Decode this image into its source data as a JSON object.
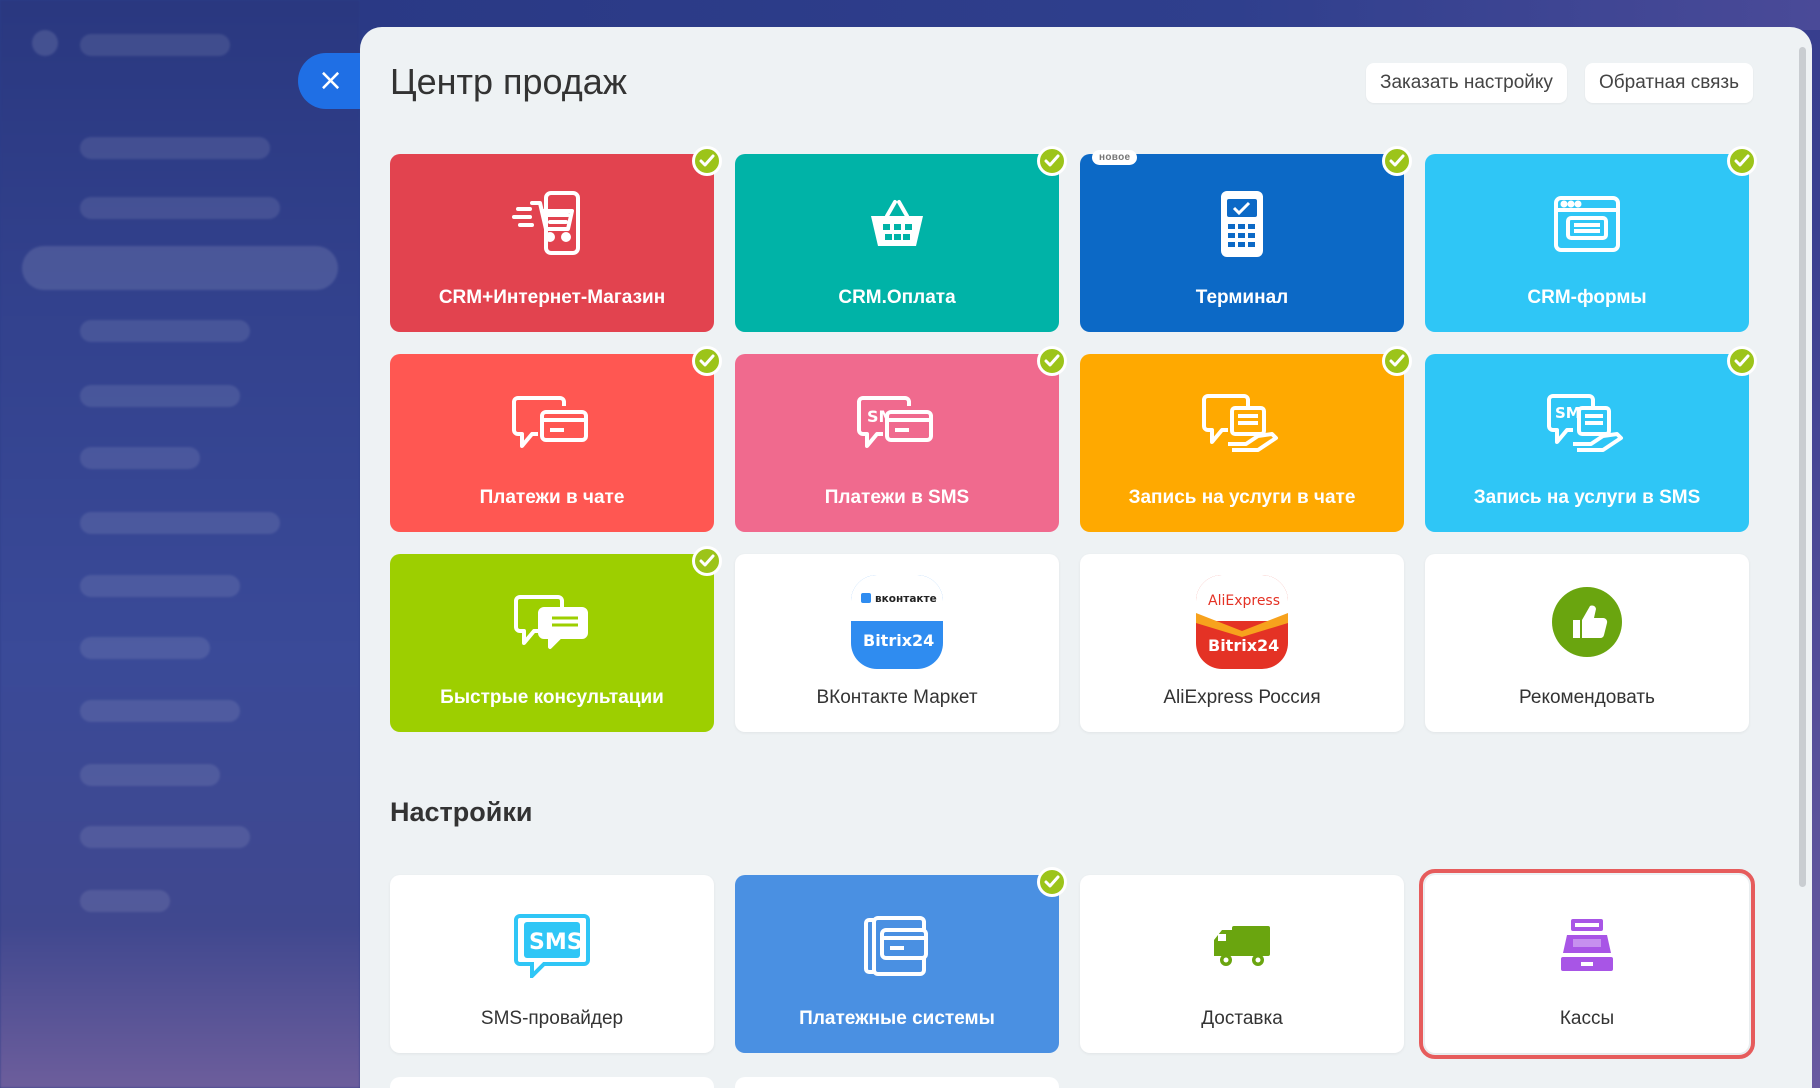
{
  "header": {
    "title": "Центр продаж",
    "order_setup_label": "Заказать настройку",
    "feedback_label": "Обратная связь",
    "close_label": "×"
  },
  "settings_title": "Настройки",
  "new_badge": "новое",
  "tiles": [
    {
      "label": "CRM+Интернет-Магазин",
      "color": "#e2434f",
      "icon": "shopping-cart-phone-icon",
      "checked": true
    },
    {
      "label": "CRM.Оплата",
      "color": "#00b3a7",
      "icon": "basket-icon",
      "checked": true
    },
    {
      "label": "Терминал",
      "color": "#0c69c6",
      "icon": "payment-terminal-icon",
      "checked": true
    },
    {
      "label": "CRM-формы",
      "color": "#2fc6f6",
      "icon": "web-form-icon",
      "checked": true
    },
    {
      "label": "Платежи в чате",
      "color": "#ff5752",
      "icon": "chat-card-icon",
      "checked": true
    },
    {
      "label": "Платежи в SMS",
      "color": "#f06a8e",
      "icon": "sms-card-icon",
      "checked": true
    },
    {
      "label": "Запись на услуги в чате",
      "color": "#ffa900",
      "icon": "chat-booking-icon",
      "checked": true
    },
    {
      "label": "Запись на услуги в SMS",
      "color": "#2fc6f6",
      "icon": "sms-booking-icon",
      "checked": true
    },
    {
      "label": "Быстрые консультации",
      "color": "#9dcf00",
      "icon": "chat-bubbles-icon",
      "checked": true
    },
    {
      "label": "ВКонтакте Маркет",
      "color": "#ffffff",
      "icon": "vk-bitrix24-logo",
      "checked": false
    },
    {
      "label": "AliExpress Россия",
      "color": "#ffffff",
      "icon": "aliexpress-bitrix24-logo",
      "checked": false
    },
    {
      "label": "Рекомендовать",
      "color": "#ffffff",
      "icon": "thumbs-up-icon",
      "checked": false
    }
  ],
  "settings_tiles": [
    {
      "label": "SMS-провайдер",
      "color": "#ffffff",
      "icon": "sms-bubble-icon",
      "checked": false
    },
    {
      "label": "Платежные системы",
      "color": "#4a90e2",
      "icon": "payment-cards-icon",
      "checked": true
    },
    {
      "label": "Доставка",
      "color": "#ffffff",
      "icon": "delivery-truck-icon",
      "checked": false
    },
    {
      "label": "Кассы",
      "color": "#ffffff",
      "icon": "cash-register-icon",
      "checked": false
    }
  ],
  "logos": {
    "vk_text": "вконтакте",
    "ali_text": "AliExpress",
    "bitrix_text": "Bitrix24",
    "sms_text": "SMS"
  }
}
